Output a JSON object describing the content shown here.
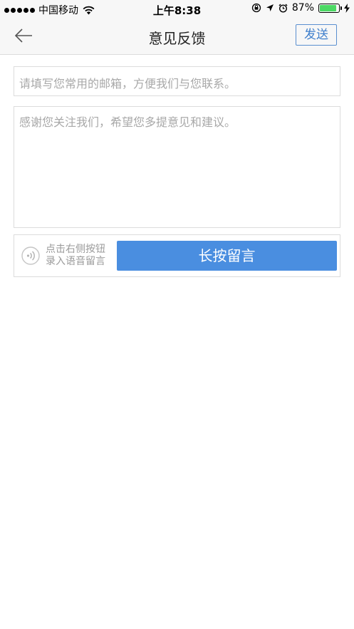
{
  "status_bar": {
    "carrier": "中国移动",
    "time": "上午8:38",
    "battery_percent": "87%",
    "battery_level": 0.87,
    "battery_color": "#4cd964"
  },
  "nav": {
    "title": "意见反馈",
    "send_label": "发送",
    "back_icon": "arrow-left-icon"
  },
  "form": {
    "email_placeholder": "请填写您常用的邮箱，方便我们与您联系。",
    "message_placeholder": "感谢您关注我们，希望您多提意见和建议。",
    "voice_hint_line1": "点击右侧按钮",
    "voice_hint_line2": "录入语音留言",
    "voice_icon": "voice-wave-icon",
    "record_label": "长按留言"
  },
  "colors": {
    "accent": "#4a8ee0",
    "border": "#dcdcdc",
    "placeholder": "#a8a8a8"
  }
}
